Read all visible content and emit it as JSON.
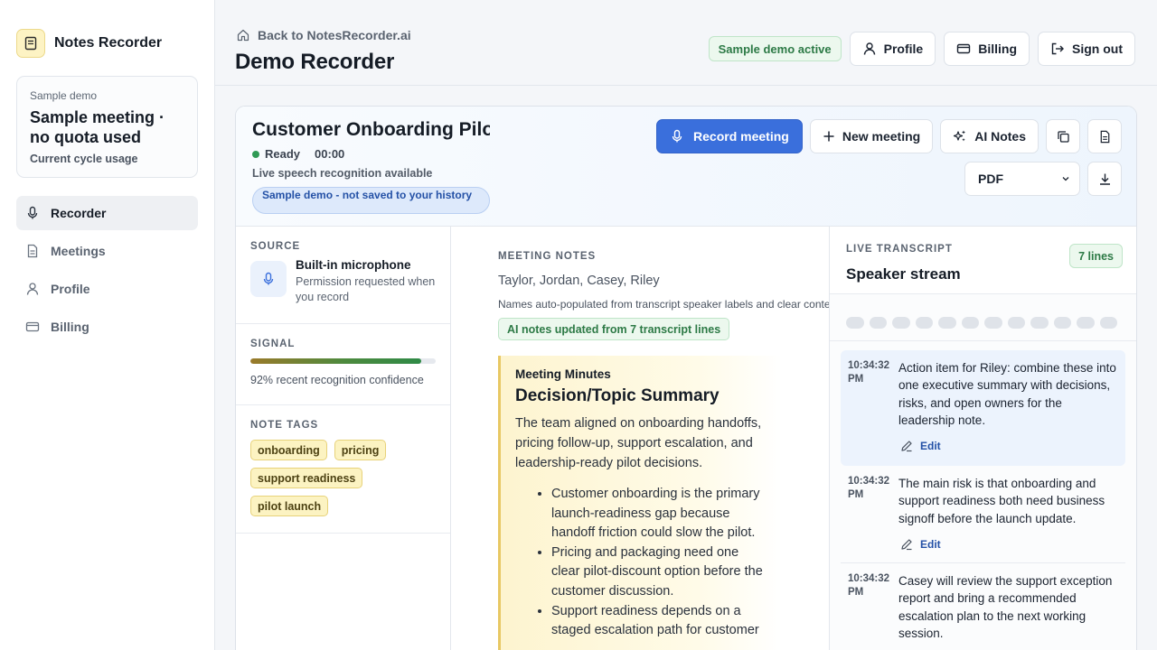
{
  "app": {
    "name": "Notes Recorder"
  },
  "usage": {
    "eyebrow": "Sample demo",
    "title": "Sample meeting · no quota used",
    "subtitle": "Current cycle usage"
  },
  "sidebar": {
    "items": [
      {
        "label": "Recorder",
        "icon": "mic-icon",
        "active": true
      },
      {
        "label": "Meetings",
        "icon": "document-icon",
        "active": false
      },
      {
        "label": "Profile",
        "icon": "user-icon",
        "active": false
      },
      {
        "label": "Billing",
        "icon": "card-icon",
        "active": false
      }
    ]
  },
  "header": {
    "back_label": "Back to NotesRecorder.ai",
    "title": "Demo Recorder",
    "demo_status": "Sample demo active",
    "profile_label": "Profile",
    "billing_label": "Billing",
    "signout_label": "Sign out"
  },
  "meeting": {
    "title": "Customer Onboarding Pilot",
    "status": "Ready",
    "timer": "00:00",
    "speech_note": "Live speech recognition available",
    "sample_badge": "Sample demo - not saved to your history",
    "record_label": "Record meeting",
    "new_label": "New meeting",
    "ai_label": "AI Notes",
    "export_format": "PDF"
  },
  "source": {
    "eyebrow": "SOURCE",
    "device": "Built-in microphone",
    "permission": "Permission requested when you record"
  },
  "signal": {
    "eyebrow": "SIGNAL",
    "confidence": 0.92,
    "text": "92% recent recognition confidence"
  },
  "tags": {
    "eyebrow": "NOTE TAGS",
    "items": [
      "onboarding",
      "pricing",
      "support readiness",
      "pilot launch"
    ]
  },
  "notes": {
    "eyebrow": "MEETING NOTES",
    "attendees": "Taylor, Jordan, Casey, Riley",
    "attendee_note": "Names auto-populated from transcript speaker labels and clear context.",
    "ai_status": "AI notes updated from 7 transcript lines",
    "kicker": "Meeting Minutes",
    "heading": "Decision/Topic Summary",
    "summary": "The team aligned on onboarding handoffs, pricing follow-up, support escalation, and leadership-ready pilot decisions.",
    "bullets": [
      "Customer onboarding is the primary launch-readiness gap because handoff friction could slow the pilot.",
      "Pricing and packaging need one clear pilot-discount option before the customer discussion.",
      "Support readiness depends on a staged escalation path for customer"
    ]
  },
  "transcript": {
    "eyebrow": "LIVE TRANSCRIPT",
    "title": "Speaker stream",
    "lines_badge": "7 lines",
    "edit_label": "Edit",
    "entries": [
      {
        "time": "10:34:32 PM",
        "text": "Action item for Riley: combine these into one executive summary with decisions, risks, and open owners for the leadership note."
      },
      {
        "time": "10:34:32 PM",
        "text": "The main risk is that onboarding and support readiness both need business signoff before the launch update."
      },
      {
        "time": "10:34:32 PM",
        "text": "Casey will review the support exception report and bring a recommended escalation plan to the next working session."
      }
    ]
  }
}
